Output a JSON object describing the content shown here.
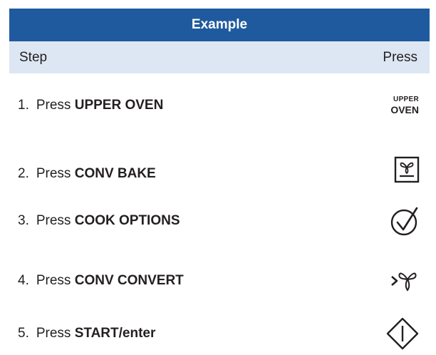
{
  "table": {
    "title": "Example",
    "col_step": "Step",
    "col_press": "Press"
  },
  "steps": [
    {
      "num": "1.",
      "verb": "Press",
      "key": "UPPER OVEN",
      "icon": "upper-oven-button",
      "icon_line1": "UPPER",
      "icon_line2": "OVEN"
    },
    {
      "num": "2.",
      "verb": "Press",
      "key": "CONV BAKE",
      "icon": "conv-bake-icon"
    },
    {
      "num": "3.",
      "verb": "Press",
      "key": "COOK OPTIONS",
      "icon": "check-circle-icon"
    },
    {
      "num": "4.",
      "verb": "Press",
      "key": "CONV CONVERT",
      "icon": "conv-convert-icon"
    },
    {
      "num": "5.",
      "verb": "Press",
      "key": "START/enter",
      "icon": "start-enter-icon"
    }
  ],
  "colors": {
    "header_bg": "#1f5a9e",
    "subheader_bg": "#dde7f3",
    "text": "#231f20"
  }
}
